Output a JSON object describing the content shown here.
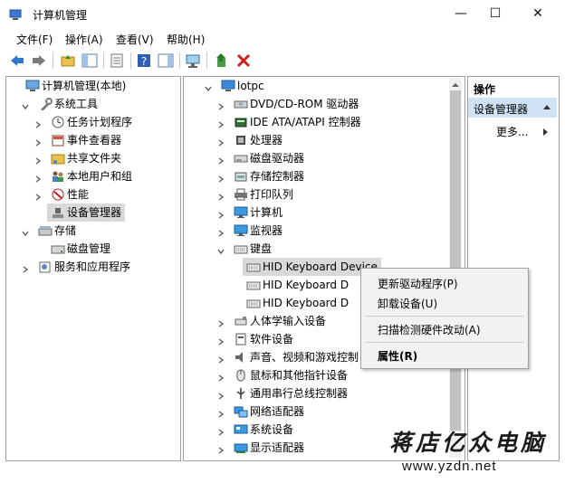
{
  "window": {
    "title": "计算机管理",
    "minimize": "—",
    "maximize": "☐",
    "close": "✕"
  },
  "menubar": [
    "文件(F)",
    "操作(A)",
    "查看(V)",
    "帮助(H)"
  ],
  "left_tree": [
    {
      "label": "计算机管理(本地)",
      "icon": "computer-manage-icon",
      "expander": "",
      "indent": 0
    },
    {
      "label": "系统工具",
      "icon": "system-tools-icon",
      "expander": "down",
      "indent": 1
    },
    {
      "label": "任务计划程序",
      "icon": "clock-icon",
      "expander": "right",
      "indent": 2
    },
    {
      "label": "事件查看器",
      "icon": "event-viewer-icon",
      "expander": "right",
      "indent": 2
    },
    {
      "label": "共享文件夹",
      "icon": "shared-folder-icon",
      "expander": "right",
      "indent": 2
    },
    {
      "label": "本地用户和组",
      "icon": "users-icon",
      "expander": "right",
      "indent": 2
    },
    {
      "label": "性能",
      "icon": "performance-icon",
      "expander": "right",
      "indent": 2
    },
    {
      "label": "设备管理器",
      "icon": "device-manager-icon",
      "expander": "",
      "indent": 2,
      "selected": true
    },
    {
      "label": "存储",
      "icon": "storage-icon",
      "expander": "down",
      "indent": 1
    },
    {
      "label": "磁盘管理",
      "icon": "disk-icon",
      "expander": "",
      "indent": 2
    },
    {
      "label": "服务和应用程序",
      "icon": "services-icon",
      "expander": "right",
      "indent": 1
    }
  ],
  "device_tree": [
    {
      "label": "lotpc",
      "icon": "computer-icon",
      "expander": "down",
      "indent": 0
    },
    {
      "label": "DVD/CD-ROM 驱动器",
      "icon": "dvd-icon",
      "expander": "right",
      "indent": 1
    },
    {
      "label": "IDE ATA/ATAPI 控制器",
      "icon": "ide-icon",
      "expander": "right",
      "indent": 1
    },
    {
      "label": "处理器",
      "icon": "processor-icon",
      "expander": "right",
      "indent": 1
    },
    {
      "label": "磁盘驱动器",
      "icon": "disk-drive-icon",
      "expander": "right",
      "indent": 1
    },
    {
      "label": "存储控制器",
      "icon": "storage-controller-icon",
      "expander": "right",
      "indent": 1
    },
    {
      "label": "打印队列",
      "icon": "printer-icon",
      "expander": "right",
      "indent": 1
    },
    {
      "label": "计算机",
      "icon": "monitor-icon",
      "expander": "right",
      "indent": 1
    },
    {
      "label": "监视器",
      "icon": "monitor-icon",
      "expander": "right",
      "indent": 1
    },
    {
      "label": "键盘",
      "icon": "keyboard-icon",
      "expander": "down",
      "indent": 1
    },
    {
      "label": "HID Keyboard Device",
      "icon": "keyboard-icon",
      "expander": "",
      "indent": 2,
      "selected": true
    },
    {
      "label": "HID Keyboard D",
      "icon": "keyboard-icon",
      "expander": "",
      "indent": 2
    },
    {
      "label": "HID Keyboard D",
      "icon": "keyboard-icon",
      "expander": "",
      "indent": 2
    },
    {
      "label": "人体学输入设备",
      "icon": "hid-icon",
      "expander": "right",
      "indent": 1
    },
    {
      "label": "软件设备",
      "icon": "software-device-icon",
      "expander": "right",
      "indent": 1
    },
    {
      "label": "声音、视频和游戏控制",
      "icon": "sound-icon",
      "expander": "right",
      "indent": 1
    },
    {
      "label": "鼠标和其他指针设备",
      "icon": "mouse-icon",
      "expander": "right",
      "indent": 1
    },
    {
      "label": "通用串行总线控制器",
      "icon": "usb-icon",
      "expander": "right",
      "indent": 1
    },
    {
      "label": "网络适配器",
      "icon": "network-icon",
      "expander": "right",
      "indent": 1
    },
    {
      "label": "系统设备",
      "icon": "system-device-icon",
      "expander": "right",
      "indent": 1
    },
    {
      "label": "显示适配器",
      "icon": "display-adapter-icon",
      "expander": "right",
      "indent": 1
    }
  ],
  "context_menu": {
    "items": [
      "更新驱动程序(P)",
      "卸载设备(U)",
      "扫描检测硬件改动(A)",
      "属性(R)"
    ]
  },
  "actions_pane": {
    "header": "操作",
    "selected": "设备管理器",
    "more": "更多..."
  },
  "watermark": {
    "line1": "蒋店亿众电脑",
    "line2": "www.yzdn.net"
  },
  "colors": {
    "selection": "#d9d9d9",
    "accent": "#cfe3f5",
    "delete_red": "#d0201a"
  }
}
